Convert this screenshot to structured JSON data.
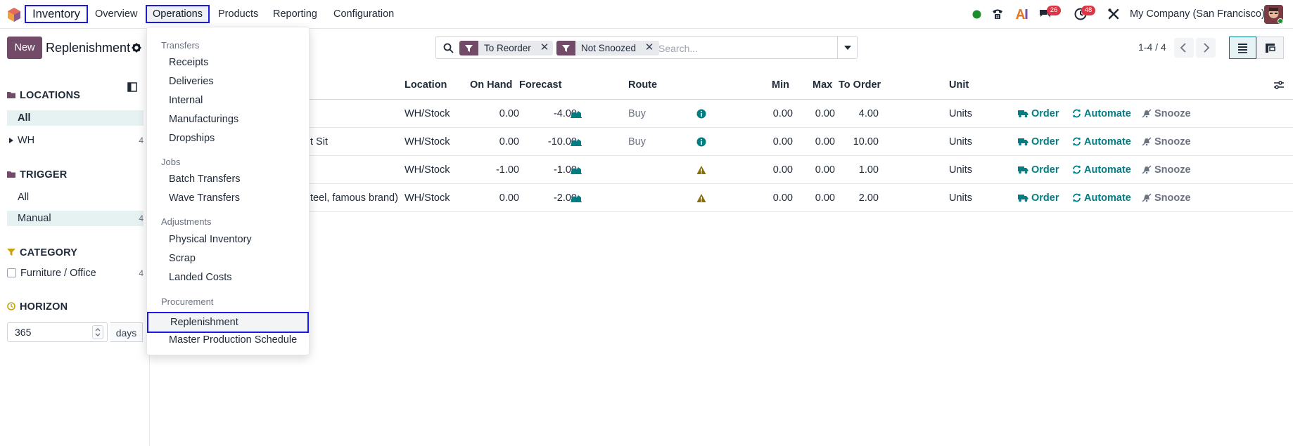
{
  "navbar": {
    "app_name": "Inventory",
    "menu": [
      "Overview",
      "Operations",
      "Products",
      "Reporting",
      "Configuration"
    ],
    "badges": {
      "messages": "26",
      "activities": "48"
    },
    "company": "My Company (San Francisco)",
    "icons": [
      "odoo-logo-icon",
      "status-dot-icon",
      "phone-icon",
      "ai-icon",
      "chat-icon",
      "clock-icon",
      "tools-icon"
    ]
  },
  "control_panel": {
    "new_label": "New",
    "title": "Replenishment",
    "facets": [
      "To Reorder",
      "Not Snoozed"
    ],
    "search_placeholder": "Search...",
    "pager": "1-4 / 4"
  },
  "sidebar": {
    "locations": {
      "title": "LOCATIONS",
      "items": [
        {
          "label": "All",
          "count": ""
        },
        {
          "label": "WH",
          "count": "4"
        }
      ]
    },
    "trigger": {
      "title": "TRIGGER",
      "items": [
        {
          "label": "All",
          "count": ""
        },
        {
          "label": "Manual",
          "count": "4"
        }
      ]
    },
    "category": {
      "title": "CATEGORY",
      "items": [
        {
          "label": "Furniture / Office",
          "count": "4"
        }
      ]
    },
    "horizon": {
      "title": "HORIZON",
      "value": "365",
      "unit": "days"
    }
  },
  "table": {
    "headers": [
      "Location",
      "On Hand",
      "Forecast",
      "Route",
      "Min",
      "Max",
      "To Order",
      "Unit"
    ],
    "rows": [
      {
        "product": "",
        "location": "WH/Stock",
        "on_hand": "0.00",
        "forecast": "-4.00",
        "route": "Buy",
        "min": "0.00",
        "max": "0.00",
        "to_order": "4.00",
        "unit": "Units"
      },
      {
        "product": "t Sit",
        "location": "WH/Stock",
        "on_hand": "0.00",
        "forecast": "-10.00",
        "route": "Buy",
        "min": "0.00",
        "max": "0.00",
        "to_order": "10.00",
        "unit": "Units"
      },
      {
        "product": "",
        "location": "WH/Stock",
        "on_hand": "-1.00",
        "forecast": "-1.00",
        "route": "",
        "min": "0.00",
        "max": "0.00",
        "to_order": "1.00",
        "unit": "Units"
      },
      {
        "product": "teel, famous brand)",
        "location": "WH/Stock",
        "on_hand": "0.00",
        "forecast": "-2.00",
        "route": "",
        "min": "0.00",
        "max": "0.00",
        "to_order": "2.00",
        "unit": "Units"
      }
    ],
    "actions": {
      "order": "Order",
      "automate": "Automate",
      "snooze": "Snooze"
    },
    "colors": {
      "accent": "#017e84",
      "warning": "#8a6d05",
      "brand": "#714b67"
    }
  },
  "operations_menu": {
    "sections": [
      {
        "header": "Transfers",
        "items": [
          "Receipts",
          "Deliveries",
          "Internal",
          "Manufacturings",
          "Dropships"
        ]
      },
      {
        "header": "Jobs",
        "items": [
          "Batch Transfers",
          "Wave Transfers"
        ]
      },
      {
        "header": "Adjustments",
        "items": [
          "Physical Inventory",
          "Scrap",
          "Landed Costs"
        ]
      },
      {
        "header": "Procurement",
        "items": [
          "Replenishment",
          "Master Production Schedule"
        ]
      }
    ]
  }
}
